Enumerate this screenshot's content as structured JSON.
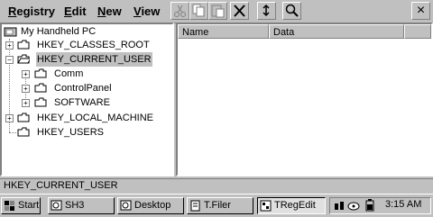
{
  "menu": {
    "items": [
      "Registry",
      "Edit",
      "New",
      "View"
    ]
  },
  "toolbar": {
    "buttons": [
      "cut-icon",
      "copy-icon",
      "paste-icon",
      "delete-icon",
      "refresh-icon",
      "find-icon"
    ],
    "close_label": "×"
  },
  "tree": {
    "root": "My Handheld PC",
    "items": [
      {
        "label": "HKEY_CLASSES_ROOT",
        "expander": "+",
        "selected": false
      },
      {
        "label": "HKEY_CURRENT_USER",
        "expander": "−",
        "selected": true
      },
      {
        "label": "Comm",
        "expander": "+",
        "selected": false
      },
      {
        "label": "ControlPanel",
        "expander": "+",
        "selected": false
      },
      {
        "label": "SOFTWARE",
        "expander": "+",
        "selected": false
      },
      {
        "label": "HKEY_LOCAL_MACHINE",
        "expander": "+",
        "selected": false
      },
      {
        "label": "HKEY_USERS",
        "expander": "",
        "selected": false
      }
    ]
  },
  "list": {
    "columns": [
      "Name",
      "Data"
    ]
  },
  "status": {
    "text": "HKEY_CURRENT_USER"
  },
  "taskbar": {
    "start_label": "Start",
    "tasks": [
      "SH3",
      "Desktop",
      "T.Filer",
      "TRegEdit"
    ],
    "clock": "3:15 AM"
  },
  "colors": {
    "selection": "#c0c0c0",
    "face": "#c0c0c0"
  }
}
